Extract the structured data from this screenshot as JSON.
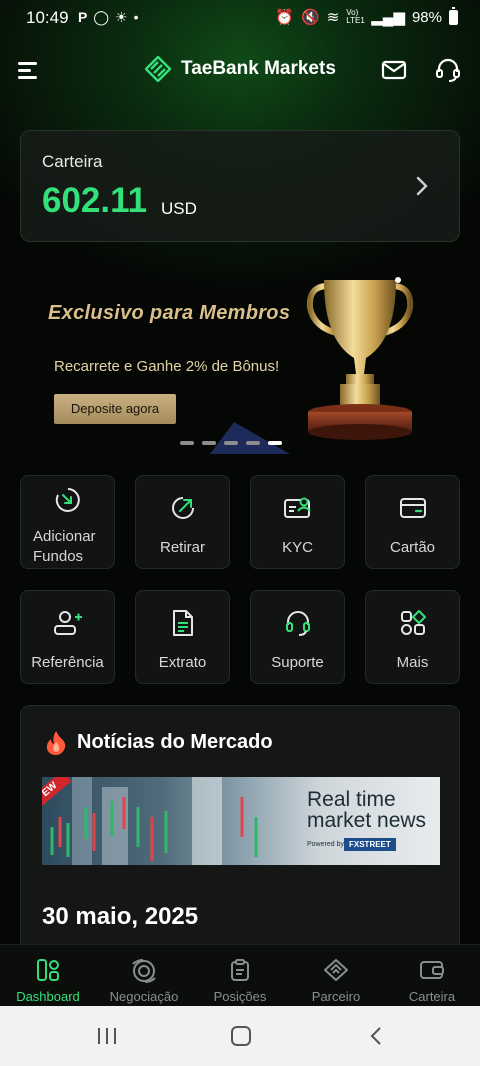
{
  "status_bar": {
    "time": "10:49",
    "battery": "98%",
    "lte_label": "Vo) LTE1"
  },
  "header": {
    "title": "TaeBank Markets"
  },
  "wallet": {
    "label": "Carteira",
    "amount": "602.11",
    "currency": "USD"
  },
  "banner": {
    "title": "Exclusivo para Membros",
    "subtitle": "Recarrete e Ganhe 2% de Bônus!",
    "button": "Deposite agora",
    "slide_count": 5,
    "active_slide": 5
  },
  "actions": [
    {
      "label": "Adicionar Fundos",
      "icon": "add-funds-icon"
    },
    {
      "label": "Retirar",
      "icon": "withdraw-icon"
    },
    {
      "label": "KYC",
      "icon": "kyc-icon"
    },
    {
      "label": "Cartão",
      "icon": "card-icon"
    },
    {
      "label": "Referência",
      "icon": "referral-icon"
    },
    {
      "label": "Extrato",
      "icon": "statement-icon"
    },
    {
      "label": "Suporte",
      "icon": "support-icon"
    },
    {
      "label": "Mais",
      "icon": "more-icon"
    }
  ],
  "news": {
    "title": "Notícias do Mercado",
    "image_headline_1": "Real time",
    "image_headline_2": "market news",
    "image_powered": "Powered by",
    "image_brand": "FXSTREET",
    "image_corner": "EW",
    "date": "30 maio, 2025"
  },
  "bottom_nav": [
    {
      "label": "Dashboard",
      "icon": "dashboard-icon",
      "active": true
    },
    {
      "label": "Negociação",
      "icon": "trading-icon",
      "active": false
    },
    {
      "label": "Posições",
      "icon": "positions-icon",
      "active": false
    },
    {
      "label": "Parceiro",
      "icon": "partner-icon",
      "active": false
    },
    {
      "label": "Carteira",
      "icon": "wallet-icon",
      "active": false
    }
  ],
  "colors": {
    "accent": "#34e07a",
    "background": "#050705",
    "gold": "#d9bf8a"
  }
}
